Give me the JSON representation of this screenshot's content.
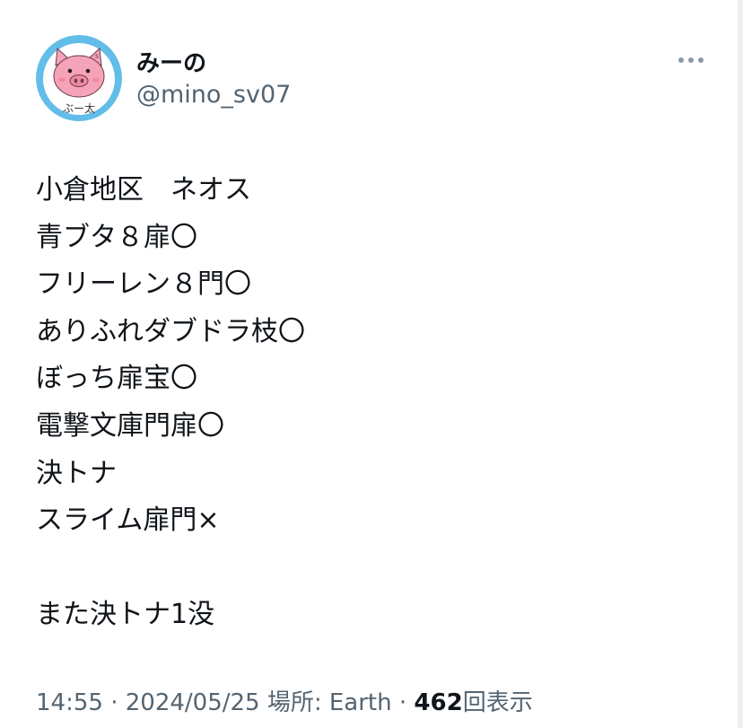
{
  "author": {
    "display_name": "みーの",
    "handle": "@mino_sv07",
    "avatar_icon": "pig-avatar-icon",
    "avatar_caption": "ぶー太"
  },
  "tweet": {
    "lines": [
      "小倉地区　ネオス",
      "青ブタ８扉〇",
      "フリーレン８門〇",
      "ありふれダブドラ枝〇",
      "ぼっち扉宝〇",
      "電撃文庫門扉〇",
      "決トナ",
      "スライム扉門×",
      "",
      "また決トナ1没"
    ]
  },
  "meta": {
    "time": "14:55",
    "sep1": " · ",
    "date": "2024/05/25",
    "space": " ",
    "location": "場所: Earth",
    "sep2": " · ",
    "views_count": "462",
    "views_label": "回表示"
  },
  "icons": {
    "more": "more-options-icon"
  },
  "colors": {
    "avatar_bg": "#62bde9",
    "pig": "#f5a3b8",
    "secondary_text": "#536471",
    "primary_text": "#0f1419"
  }
}
